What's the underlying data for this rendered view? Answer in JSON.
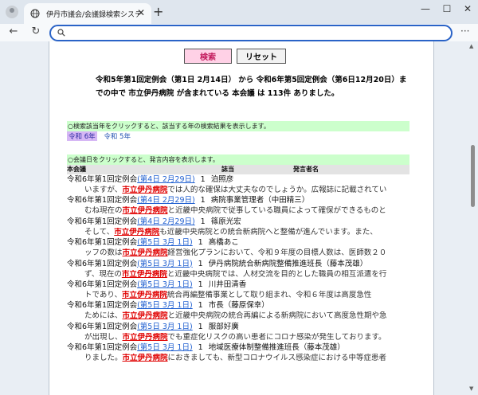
{
  "browser": {
    "tab_title": "伊丹市議会/会議録検索システム",
    "tab_close": "✕",
    "new_tab": "+",
    "back": "←",
    "reload": "↻",
    "menu": "···",
    "win_min": "—",
    "win_max": "☐",
    "win_close": "✕",
    "address": ""
  },
  "buttons": {
    "search": "検索",
    "reset": "リセット"
  },
  "summary": "令和5年第1回定例会（第1日 2月14日） から 令和6年第5回定例会（第6日12月20日）までの中で 市立伊丹病院 が含まれている 本会議 は 113件 ありました。",
  "year_hint": "○検索該当年をクリックすると、該当する年の検索結果を表示します。",
  "years": [
    "令和 6年",
    "令和 5年"
  ],
  "date_hint": "○会議日をクリックすると、発言内容を表示します。",
  "columns": {
    "meeting": "本会議",
    "turn": "誌当",
    "speaker": "発言者名"
  },
  "keyword": "市立伊丹病院",
  "results": [
    {
      "meeting": "令和6年第1回定例会",
      "date": "(第4日 2月29日)",
      "num": "1",
      "speaker": "泊照彦",
      "pre": "いますが、",
      "post": "では人的な確保は大丈夫なのでしょうか。広報誌に記載されてい"
    },
    {
      "meeting": "令和6年第1回定例会",
      "date": "(第4日 2月29日)",
      "num": "1",
      "speaker": "病院事業管理者（中田精三）",
      "pre": "むね現在の",
      "post": "と近畿中央病院で従事している職員によって確保ができるものと"
    },
    {
      "meeting": "令和6年第1回定例会",
      "date": "(第4日 2月29日)",
      "num": "1",
      "speaker": "篠原光宏",
      "pre": "そして、",
      "post": "も近畿中央病院との統合新病院へと整備が進んでいます。また、"
    },
    {
      "meeting": "令和6年第1回定例会",
      "date": "(第5日 3月 1日)",
      "num": "1",
      "speaker": "高橋あこ",
      "pre": "ッフの数は",
      "post": "経営強化プランにおいて、令和９年度の目標人数は、医師数２０"
    },
    {
      "meeting": "令和6年第1回定例会",
      "date": "(第5日 3月 1日)",
      "num": "1",
      "speaker": "伊丹病院統合新病院整備推進班長（藤本茂雄）",
      "pre": "ず、現在の",
      "post": "と近畿中央病院では、人材交流を目的とした職員の相互派遣を行"
    },
    {
      "meeting": "令和6年第1回定例会",
      "date": "(第5日 3月 1日)",
      "num": "1",
      "speaker": "川井田清香",
      "pre": "トであり、",
      "post": "統合再編整備事業として取り組まれ、令和６年度は高度急性"
    },
    {
      "meeting": "令和6年第1回定例会",
      "date": "(第5日 3月 1日)",
      "num": "1",
      "speaker": "市長（藤原保幸）",
      "pre": "ためには、",
      "post": "と近畿中央病院の統合再編による新病院において高度急性期や急"
    },
    {
      "meeting": "令和6年第1回定例会",
      "date": "(第5日 3月 1日)",
      "num": "1",
      "speaker": "服部好廣",
      "pre": "が出現し、",
      "post": "でも重症化リスクの高い患者にコロナ感染が発生しております。"
    },
    {
      "meeting": "令和6年第1回定例会",
      "date": "(第5日 3月 1日)",
      "num": "1",
      "speaker": "地域医療体制整備推進班長（藤本茂雄）",
      "pre": "りました。",
      "post": "におきましても、新型コロナウイルス感染症における中等症患者"
    }
  ]
}
